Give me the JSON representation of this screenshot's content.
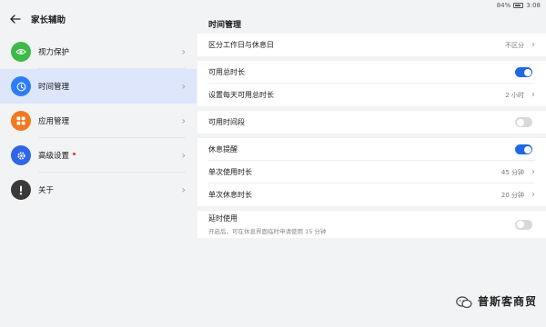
{
  "statusbar": {
    "battery": "84%",
    "time": "3:08"
  },
  "header": {
    "title": "家长辅助"
  },
  "menu": [
    {
      "label": "视力保护",
      "icon": "eye-icon",
      "color": "#3fb948",
      "dot": false,
      "selected": false
    },
    {
      "label": "时间管理",
      "icon": "clock-icon",
      "color": "#2e7cf6",
      "dot": false,
      "selected": true
    },
    {
      "label": "应用管理",
      "icon": "apps-icon",
      "color": "#f2791f",
      "dot": false,
      "selected": false
    },
    {
      "label": "高级设置",
      "icon": "gear-icon",
      "color": "#2f66e8",
      "dot": true,
      "selected": false
    },
    {
      "label": "关于",
      "icon": "info-icon",
      "color": "#3a3a3a",
      "dot": false,
      "selected": false
    }
  ],
  "main": {
    "title": "时间管理",
    "workday": {
      "label": "区分工作日与休息日",
      "value": "不区分"
    },
    "total": {
      "label": "可用总时长",
      "on": true
    },
    "daily": {
      "label": "设置每天可用总时长",
      "value": "2 小时"
    },
    "period": {
      "label": "可用时间段",
      "on": false
    },
    "rest": {
      "label": "休息提醒",
      "on": true
    },
    "single_use": {
      "label": "单次使用时长",
      "value": "45 分钟"
    },
    "single_rest": {
      "label": "单次休息时长",
      "value": "20 分钟"
    },
    "extend": {
      "label": "延时使用",
      "sub": "开启后，可在休息界面临时申请使用 15 分钟",
      "on": false
    }
  },
  "watermark": {
    "text": "普斯客商贸"
  },
  "colors": {
    "accent": "#1f68e6",
    "selected_bg": "#dde6fa"
  }
}
